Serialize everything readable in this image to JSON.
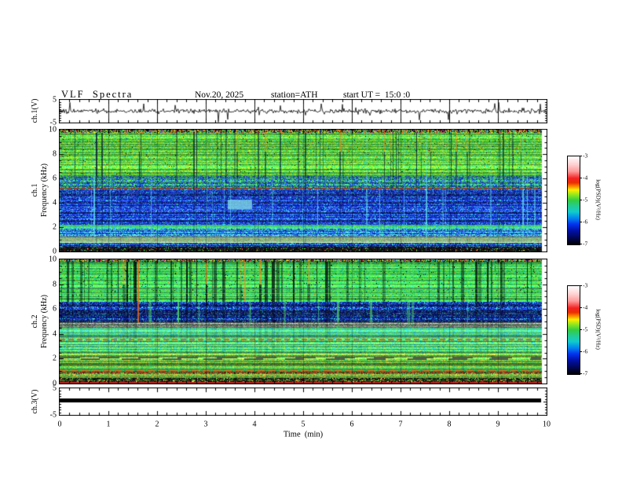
{
  "header": {
    "title": "VLF  Spectra",
    "date": "Nov.20, 2025",
    "station": "station=ATH",
    "start_ut": "start UT =  15:0 :0"
  },
  "x_axis": {
    "label": "Time  (min)",
    "ticks": [
      "0",
      "1",
      "2",
      "3",
      "4",
      "5",
      "6",
      "7",
      "8",
      "9",
      "10"
    ],
    "range_min": [
      0,
      10
    ]
  },
  "panels": {
    "ch1_wave": {
      "ylabel": "ch.1(V)",
      "ylim": [
        -5,
        5
      ],
      "yticks": [
        {
          "v": 5,
          "t": "5"
        },
        {
          "v": -5,
          "t": "-5"
        }
      ]
    },
    "ch1_spec": {
      "ylabel_lines": [
        "ch.1",
        "Frequency  (kHz)"
      ],
      "ylim_khz": [
        0,
        10
      ],
      "yticks": [
        {
          "v": 10,
          "t": "10"
        },
        {
          "v": 8,
          "t": "8"
        },
        {
          "v": 6,
          "t": "6"
        },
        {
          "v": 4,
          "t": "4"
        },
        {
          "v": 2,
          "t": "2"
        },
        {
          "v": 0,
          "t": "0"
        }
      ]
    },
    "ch2_spec": {
      "ylabel_lines": [
        "ch.2",
        "Frequency  (kHz)"
      ],
      "ylim_khz": [
        0,
        10
      ],
      "yticks": [
        {
          "v": 10,
          "t": "10"
        },
        {
          "v": 8,
          "t": "8"
        },
        {
          "v": 6,
          "t": "6"
        },
        {
          "v": 4,
          "t": "4"
        },
        {
          "v": 2,
          "t": "2"
        },
        {
          "v": 0,
          "t": "0"
        }
      ]
    },
    "ch3_wave": {
      "ylabel": "ch.3(V)",
      "ylim": [
        -5,
        5
      ],
      "yticks": [
        {
          "v": 5,
          "t": "5"
        },
        {
          "v": -5,
          "t": "-5"
        }
      ]
    }
  },
  "colorbar": {
    "label": "log(PSD)(V²/Hz)",
    "ticks": [
      "-3",
      "-4",
      "-5",
      "-6",
      "-7"
    ],
    "values": [
      -3,
      -4,
      -5,
      -6,
      -7
    ],
    "gradient": [
      "#ffffff 0%",
      "#ffd2d2 9%",
      "#ff9a9a 17%",
      "#f22222 25%",
      "#e83000 30%",
      "#ff8800 34%",
      "#ffee00 38%",
      "#88e622 44%",
      "#33cc44 50%",
      "#22cc99 57%",
      "#11cccc 63%",
      "#0088ee 70%",
      "#0033ee 77%",
      "#0012aa 84%",
      "#000866 91%",
      "#000000 100%"
    ]
  },
  "chart_data": {
    "type": "heatmap",
    "title": "VLF Spectra quicklook, station ATH, Nov.20 2025, start 15:00:00 UT",
    "time_range_min": [
      0,
      10
    ],
    "data_end_min": 9.9,
    "psd_scale_log": [
      -7,
      -3
    ],
    "panels": [
      {
        "id": "ch1_wave",
        "type": "line",
        "ylim_v": [
          -5,
          5
        ],
        "signal": {
          "seed": 21,
          "baseline_v": 0,
          "noise_v": 0.55,
          "spike_prob": 0.024,
          "spike_vmin": 1.0,
          "spike_vmax": 4.3,
          "color": "#000000"
        }
      },
      {
        "id": "ch1_spec",
        "type": "heatmap",
        "ylim_khz": [
          0,
          10
        ],
        "seed": 7,
        "streaks": {
          "density": 0.3,
          "wmax": 2,
          "darkFrac": 0.74,
          "dark": "#000d33",
          "bright": "#66e8ee",
          "orangeFrac": 0.3,
          "orange": "#ff7711",
          "orangeAbove": 8.2
        },
        "bands": [
          {
            "f": [
              9.75,
              10.01
            ],
            "colors": [
              "#cc2222",
              "#ddcc22",
              "#44bb44",
              "#111111",
              "#33bbcc",
              "#ee7722",
              "#2244cc"
            ],
            "weights": [
              2,
              2,
              3,
              3,
              1,
              1,
              1
            ],
            "hjitter": 0.1,
            "streaks": {
              "dark": 0.2,
              "bright": 0
            }
          },
          {
            "f": [
              6.2,
              9.75
            ],
            "colors": [
              "#55cc33",
              "#88dd33",
              "#33bb55",
              "#bbe633",
              "#44ddaa"
            ],
            "weights": [
              4,
              3,
              3,
              1,
              1
            ],
            "hjitter": 0.35,
            "streaks": {
              "dark": 0.88,
              "bright": 0.35
            },
            "pepper": [
              {
                "c": "#ee4411",
                "p": 0.004
              },
              {
                "c": "#111111",
                "p": 0.01
              }
            ]
          },
          {
            "f": [
              5.1,
              6.2
            ],
            "colors": [
              "#44bb44",
              "#2255cc",
              "#33aa66",
              "#1133aa",
              "#44ccbb"
            ],
            "weights": [
              3,
              3,
              2,
              2,
              1
            ],
            "hjitter": 0.45,
            "streaks": {
              "dark": 0.6,
              "bright": 0.6
            }
          },
          {
            "f": [
              2.2,
              5.1
            ],
            "colors": [
              "#2244dd",
              "#1130b0",
              "#0a1878",
              "#3366ee",
              "#33bbee"
            ],
            "weights": [
              3,
              3,
              2,
              2,
              1
            ],
            "hjitter": 0.55,
            "streaks": {
              "dark": 0.45,
              "bright": 0.85
            },
            "pepper": [
              {
                "c": "#44cc66",
                "p": 0.01
              }
            ]
          },
          {
            "f": [
              1.85,
              2.2
            ],
            "colors": [
              "#44cc55",
              "#33bb88",
              "#22aacc",
              "#66dd44"
            ],
            "weights": [
              3,
              2,
              2,
              1
            ],
            "hjitter": 0.4,
            "streaks": {
              "dark": 0.25,
              "bright": 0.4
            }
          },
          {
            "f": [
              1.2,
              1.85
            ],
            "colors": [
              "#2266dd",
              "#33aadd",
              "#55ccee",
              "#1133aa"
            ],
            "weights": [
              3,
              2,
              2,
              2
            ],
            "hjitter": 0.5,
            "streaks": {
              "dark": 0.3,
              "bright": 0.6
            },
            "pepper": [
              {
                "c": "#55cc55",
                "p": 0.02
              }
            ]
          },
          {
            "f": [
              0.7,
              1.2
            ],
            "colors": [
              "#99bb88",
              "#aacc99",
              "#88aa77",
              "#77cc88"
            ],
            "weights": [
              3,
              3,
              2,
              1
            ],
            "hjitter": 0.35,
            "streaks": {
              "dark": 0.2,
              "bright": 0.2
            }
          },
          {
            "f": [
              0.37,
              0.7
            ],
            "colors": [
              "#2244bb",
              "#113388",
              "#33aacc",
              "#0a1a66"
            ],
            "weights": [
              3,
              2,
              2,
              2
            ],
            "hjitter": 0.5,
            "streaks": {
              "dark": 0.25,
              "bright": 0.3
            },
            "pepper": [
              {
                "c": "#44bb55",
                "p": 0.015
              }
            ]
          },
          {
            "f": [
              0,
              0.37
            ],
            "colors": [
              "#0d0d0d",
              "#1a1a1a",
              "#222222"
            ],
            "weights": [
              4,
              3,
              2
            ],
            "hjitter": 0.3,
            "streaks": {
              "dark": 0,
              "bright": 0.1
            },
            "pepper": [
              {
                "c": "#44cc44",
                "p": 0.05
              },
              {
                "c": "#cc3322",
                "p": 0.02
              },
              {
                "c": "#ddcc33",
                "p": 0.02
              },
              {
                "c": "#3399cc",
                "p": 0.02
              }
            ]
          }
        ],
        "overlays": [
          {
            "type": "hline",
            "f": 5.15,
            "color": "#a03c28",
            "thick": 2,
            "dash": [
              6,
              3
            ],
            "alpha": 0.85
          },
          {
            "type": "rect",
            "t": [
              3.45,
              3.95
            ],
            "f": [
              3.45,
              4.25
            ],
            "color": "#7fd8e8",
            "alpha": 0.8
          },
          {
            "type": "hline",
            "f": 2.02,
            "color": "#55dd44",
            "thick": 1,
            "dash": [
              9,
              4
            ],
            "alpha": 0.45
          }
        ]
      },
      {
        "id": "ch2_spec",
        "type": "heatmap",
        "ylim_khz": [
          0,
          10
        ],
        "seed": 13,
        "streaks": {
          "density": 0.34,
          "wmax": 4,
          "darkFrac": 0.8,
          "dark": "#020208",
          "bright": "#55ee66",
          "orangeFrac": 0.08,
          "orange": "#ff7711",
          "orangeAbove": 8.0
        },
        "bands": [
          {
            "f": [
              9.8,
              10.01
            ],
            "colors": [
              "#cc2222",
              "#ddcc22",
              "#44bb44",
              "#111111",
              "#33bbcc",
              "#2244cc"
            ],
            "weights": [
              2,
              2,
              3,
              2,
              1,
              1
            ],
            "hjitter": 0.1,
            "streaks": {
              "dark": 0.2,
              "bright": 0
            }
          },
          {
            "f": [
              6.6,
              9.8
            ],
            "colors": [
              "#44cc44",
              "#66dd44",
              "#22bb66",
              "#33ccaa"
            ],
            "weights": [
              4,
              3,
              3,
              1
            ],
            "hjitter": 0.4,
            "streaks": {
              "dark": 0.95,
              "bright": 0.55
            },
            "pepper": [
              {
                "c": "#ee5511",
                "p": 0.003
              },
              {
                "c": "#0a0a0a",
                "p": 0.02
              }
            ]
          },
          {
            "f": [
              4.95,
              6.6
            ],
            "colors": [
              "#1133bb",
              "#0a1d88",
              "#2255dd",
              "#33aadd",
              "#0a1255"
            ],
            "weights": [
              3,
              3,
              2,
              2,
              2
            ],
            "hjitter": 0.5,
            "streaks": {
              "dark": 0.5,
              "bright": 0.8
            },
            "pepper": [
              {
                "c": "#44cc66",
                "p": 0.012
              }
            ]
          },
          {
            "f": [
              4.5,
              4.95
            ],
            "colors": [
              "#8a948a",
              "#6a766c",
              "#9aa89a",
              "#44aa66",
              "#556055"
            ],
            "weights": [
              3,
              3,
              2,
              1,
              2
            ],
            "hjitter": 0.45,
            "streaks": {
              "dark": 0.25,
              "bright": 0.25
            }
          },
          {
            "f": [
              3.7,
              4.5
            ],
            "colors": [
              "#44cc99",
              "#55cc66",
              "#33bbcc",
              "#66dd77"
            ],
            "weights": [
              3,
              3,
              2,
              2
            ],
            "hjitter": 0.4,
            "streaks": {
              "dark": 0.2,
              "bright": 0.3
            }
          },
          {
            "f": [
              2.5,
              3.7
            ],
            "colors": [
              "#44cc66",
              "#33bb99",
              "#55dd66",
              "#22aacc",
              "#88dd55"
            ],
            "weights": [
              3,
              2,
              3,
              1,
              2
            ],
            "hjitter": 0.45,
            "streaks": {
              "dark": 0.18,
              "bright": 0.3
            },
            "pepper": [
              {
                "c": "#dddd44",
                "p": 0.01
              }
            ]
          },
          {
            "f": [
              1.35,
              2.5
            ],
            "colors": [
              "#55cc44",
              "#88dd44",
              "#bbdd44",
              "#44cc77",
              "#dddd55"
            ],
            "weights": [
              3,
              3,
              2,
              2,
              1
            ],
            "hjitter": 0.5,
            "streaks": {
              "dark": 0.12,
              "bright": 0.25
            }
          },
          {
            "f": [
              0.95,
              1.35
            ],
            "colors": [
              "#44bb44",
              "#66cc44",
              "#33aa66"
            ],
            "weights": [
              3,
              2,
              2
            ],
            "hjitter": 0.4,
            "streaks": {
              "dark": 0.12,
              "bright": 0.2
            }
          },
          {
            "f": [
              0.75,
              0.95
            ],
            "colors": [
              "#8a2818",
              "#aa4422",
              "#446622",
              "#222211",
              "#66aa33"
            ],
            "weights": [
              3,
              2,
              2,
              2,
              1
            ],
            "hjitter": 0.5,
            "streaks": {
              "dark": 0.1,
              "bright": 0.15
            }
          },
          {
            "f": [
              0.42,
              0.75
            ],
            "colors": [
              "#66cc44",
              "#aacc44",
              "#ddcc44",
              "#44aa55"
            ],
            "weights": [
              3,
              2,
              2,
              2
            ],
            "hjitter": 0.45,
            "streaks": {
              "dark": 0.1,
              "bright": 0.15
            }
          },
          {
            "f": [
              0,
              0.42
            ],
            "colors": [
              "#101008",
              "#28401c",
              "#0c0c0c",
              "#225522"
            ],
            "weights": [
              3,
              2,
              3,
              2
            ],
            "hjitter": 0.4,
            "streaks": {
              "dark": 0,
              "bright": 0.15
            },
            "pepper": [
              {
                "c": "#55cc44",
                "p": 0.05
              },
              {
                "c": "#ddcc33",
                "p": 0.03
              },
              {
                "c": "#cc3322",
                "p": 0.02
              }
            ]
          }
        ],
        "overlays": [
          {
            "type": "hline",
            "f": 7.25,
            "color": "#77dddd",
            "thick": 1,
            "dash": [
              1,
              0
            ],
            "alpha": 0.45
          },
          {
            "type": "hline",
            "f": 7.6,
            "color": "#77dddd",
            "thick": 1,
            "dash": [
              1,
              0
            ],
            "alpha": 0.35
          },
          {
            "type": "hline",
            "f": 3.55,
            "color": "#ee5511",
            "thick": 2,
            "dash": [
              7,
              4
            ],
            "alpha": 0.9
          },
          {
            "type": "hline",
            "f": 2.12,
            "color": "#4a524a",
            "thick": 2,
            "dash": [
              26,
              24
            ],
            "alpha": 0.9
          },
          {
            "type": "hline",
            "f": 1.95,
            "color": "#3c443c",
            "thick": 2,
            "dash": [
              24,
              28
            ],
            "phase": 25,
            "alpha": 0.85
          },
          {
            "type": "hline",
            "f": 1.05,
            "color": "#dd6622",
            "thick": 2,
            "dash": [
              9,
              5
            ],
            "alpha": 0.8
          },
          {
            "type": "hline",
            "f": 0.3,
            "color": "#ddcc44",
            "thick": 1,
            "dash": [
              5,
              7
            ],
            "alpha": 0.6
          },
          {
            "type": "hline",
            "f": 0.07,
            "color": "#cc2222",
            "thick": 2,
            "dash": [
              1,
              0
            ],
            "alpha": 0.9
          },
          {
            "type": "vline",
            "t": 1.62,
            "f": [
              4.9,
              10
            ],
            "color": "#ee6611",
            "w": 2,
            "alpha": 0.8
          },
          {
            "type": "vline",
            "t": 3.8,
            "f": [
              6.6,
              10
            ],
            "color": "#ff8822",
            "w": 2,
            "alpha": 0.65
          }
        ]
      },
      {
        "id": "ch3_wave",
        "type": "line",
        "ylim_v": [
          -5,
          5
        ],
        "signal": {
          "flat": true,
          "flat_value_v": 0.3,
          "thickness_px": 5,
          "end_min": 9.88,
          "color": "#000000"
        }
      }
    ]
  }
}
